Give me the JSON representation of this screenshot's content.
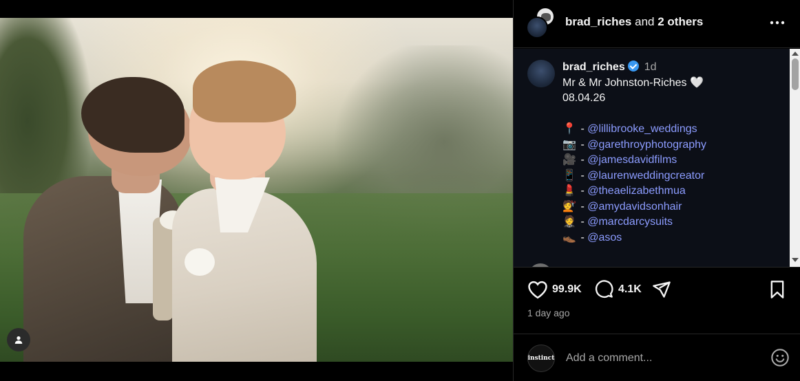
{
  "header": {
    "username": "brad_riches",
    "and_text": "and",
    "others": "2 others",
    "more_icon": "more-horizontal-icon"
  },
  "caption": {
    "username": "brad_riches",
    "time": "1d",
    "line1": "Mr & Mr Johnston-Riches 🤍",
    "line2": "08.04.26",
    "credits": [
      {
        "emoji": "📍",
        "handle": "@lillibrooke_weddings"
      },
      {
        "emoji": "📷",
        "handle": "@garethroyphotography"
      },
      {
        "emoji": "🎥",
        "handle": "@jamesdavidfilms"
      },
      {
        "emoji": "📱",
        "handle": "@laurenweddingcreator"
      },
      {
        "emoji": "💄",
        "handle": "@theaelizabethmua"
      },
      {
        "emoji": "💇",
        "handle": "@amydavidsonhair"
      },
      {
        "emoji": "🤵",
        "handle": "@marcdarcysuits"
      },
      {
        "emoji": "👞",
        "handle": "@asos"
      }
    ]
  },
  "actions": {
    "likes": "99.9K",
    "comments": "4.1K",
    "posted": "1 day ago"
  },
  "comment_bar": {
    "avatar_text": "instinct",
    "placeholder": "Add a comment..."
  },
  "colors": {
    "background": "#000000",
    "caption_bg": "#0c0f17",
    "link": "#8c9cff",
    "muted": "#a8a8a8",
    "verified": "#3897f0"
  }
}
